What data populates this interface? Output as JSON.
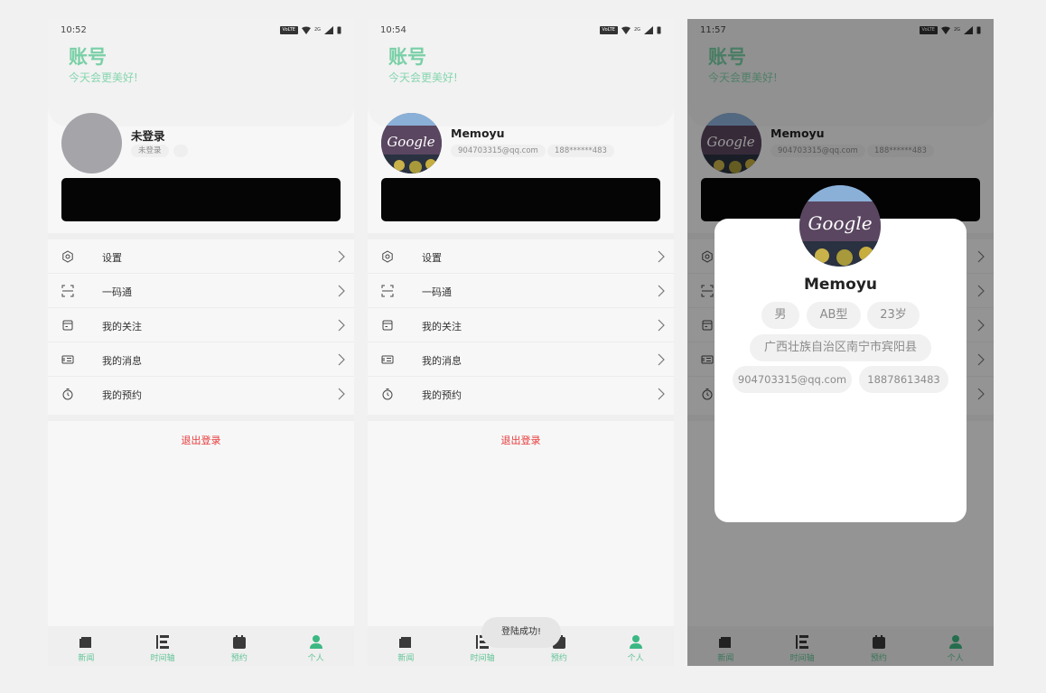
{
  "screens": [
    {
      "time": "10:52",
      "header": {
        "title": "账号",
        "subtitle": "今天会更美好!"
      },
      "profile": {
        "name": "未登录",
        "chip1": "未登录",
        "chip2": ""
      },
      "toast": ""
    },
    {
      "time": "10:54",
      "header": {
        "title": "账号",
        "subtitle": "今天会更美好!"
      },
      "profile": {
        "name": "Memoyu",
        "chip1": "904703315@qq.com",
        "chip2": "188******483"
      },
      "toast": "登陆成功!"
    },
    {
      "time": "11:57",
      "header": {
        "title": "账号",
        "subtitle": "今天会更美好!"
      },
      "profile": {
        "name": "Memoyu",
        "chip1": "904703315@qq.com",
        "chip2": "188******483"
      },
      "toast": ""
    }
  ],
  "status": {
    "volte": "VoLTE",
    "net": "2G"
  },
  "menu": [
    {
      "label": "设置",
      "icon": "settings-hex-icon"
    },
    {
      "label": "一码通",
      "icon": "scan-icon"
    },
    {
      "label": "我的关注",
      "icon": "follow-icon"
    },
    {
      "label": "我的消息",
      "icon": "message-icon"
    },
    {
      "label": "我的预约",
      "icon": "timer-icon"
    }
  ],
  "logout_label": "退出登录",
  "tabs": [
    {
      "label": "新闻",
      "icon": "news-icon"
    },
    {
      "label": "时间轴",
      "icon": "timeline-icon"
    },
    {
      "label": "预约",
      "icon": "calendar-icon"
    },
    {
      "label": "个人",
      "icon": "person-icon"
    }
  ],
  "avatar_text": "Google",
  "modal": {
    "name": "Memoyu",
    "gender": "男",
    "blood": "AB型",
    "age": "23岁",
    "address": "广西壮族自治区南宁市宾阳县",
    "email": "904703315@qq.com",
    "phone": "18878613483"
  },
  "colors": {
    "accent": "#79d0a6",
    "logout": "#e8393a",
    "tab_active": "#3cb883",
    "tab_inactive": "#3a3a3a"
  }
}
